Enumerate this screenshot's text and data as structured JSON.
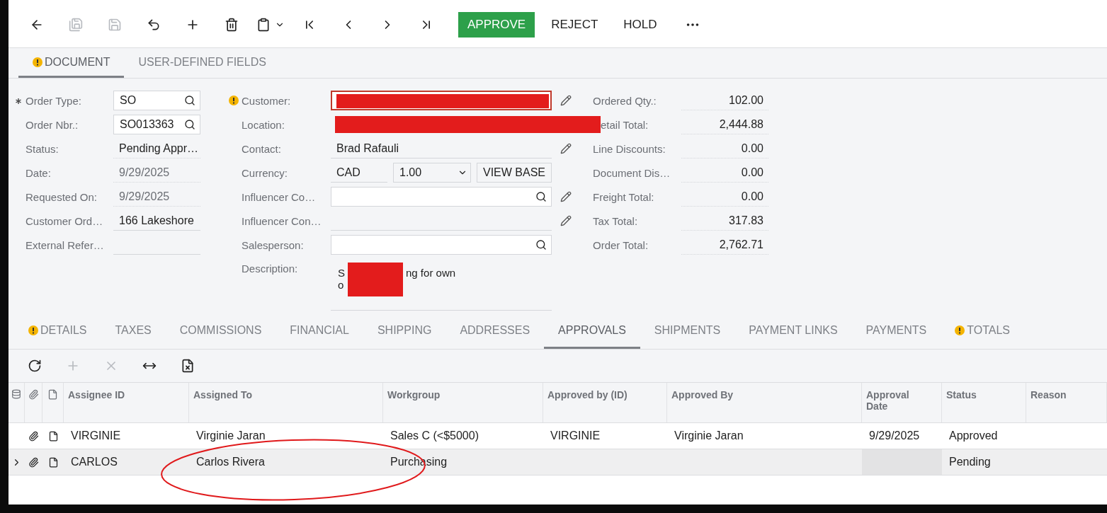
{
  "toolbar": {
    "icons": [
      {
        "disabled": false
      },
      {
        "disabled": true
      },
      {
        "disabled": true
      },
      {
        "disabled": false
      },
      {
        "disabled": false
      },
      {
        "disabled": false
      },
      {
        "disabled": false
      },
      {
        "disabled": false
      },
      {
        "disabled": false
      },
      {
        "disabled": false
      },
      {
        "disabled": false
      }
    ],
    "buttons": [
      {
        "label": "APPROVE",
        "primary": true
      },
      {
        "label": "REJECT",
        "primary": false
      },
      {
        "label": "HOLD",
        "primary": false
      }
    ]
  },
  "tabs": [
    {
      "label": "DOCUMENT",
      "selected": true,
      "warning": true
    },
    {
      "label": "USER-DEFINED FIELDS",
      "selected": false,
      "warning": false
    }
  ],
  "form": {
    "column_1": [
      {
        "kind": "lookup",
        "label": "Order Type:",
        "required": true,
        "value": "SO"
      },
      {
        "kind": "lookup",
        "label": "Order Nbr.:",
        "required": false,
        "value": "SO013363"
      },
      {
        "kind": "display",
        "label": "Status:",
        "value": "Pending Appr…",
        "disabled": false
      },
      {
        "kind": "display",
        "label": "Date:",
        "value": "9/29/2025",
        "disabled": true
      },
      {
        "kind": "display",
        "label": "Requested On:",
        "value": "9/29/2025",
        "disabled": true
      },
      {
        "kind": "text",
        "label": "Customer Ord…",
        "value": "166 Lakeshore"
      },
      {
        "kind": "text",
        "label": "External Refer…"
      }
    ],
    "column_2": [
      {
        "kind": "redacted",
        "label": "Customer:",
        "warning": true,
        "error": true,
        "edit": true
      },
      {
        "kind": "redacted-wide",
        "label": "Location:",
        "warning": false,
        "error": false,
        "edit": false
      },
      {
        "kind": "text",
        "label": "Contact:",
        "value": "Brad Rafauli",
        "edit": true
      },
      {
        "kind": "currency",
        "label": "Currency:",
        "value": "CAD",
        "rate": "1.00",
        "button": "VIEW BASE",
        "edit": false
      },
      {
        "kind": "lookup",
        "label": "Influencer Co…",
        "edit": true
      },
      {
        "kind": "text",
        "label": "Influencer Con…",
        "edit": true
      },
      {
        "kind": "lookup",
        "label": "Salesperson:",
        "edit": false
      },
      {
        "kind": "textarea",
        "label": "Description:",
        "fragments": [
          "S",
          "ng for own",
          "o"
        ],
        "redacted": true,
        "edit": false
      }
    ],
    "column_3": [
      {
        "label": "Ordered Qty.:",
        "value": "102.00",
        "clipped": false
      },
      {
        "label": "etail Total:",
        "value": "2,444.88",
        "clipped": true
      },
      {
        "label": "Line Discounts:",
        "value": "0.00",
        "clipped": false
      },
      {
        "label": "Document Dis…",
        "value": "0.00",
        "clipped": false
      },
      {
        "label": "Freight Total:",
        "value": "0.00",
        "clipped": false
      },
      {
        "label": "Tax Total:",
        "value": "317.83",
        "clipped": false
      },
      {
        "label": "Order Total:",
        "value": "2,762.71",
        "clipped": false
      }
    ]
  },
  "detail_tabs": [
    {
      "label": "DETAILS",
      "selected": false,
      "warning": true
    },
    {
      "label": "TAXES",
      "selected": false,
      "warning": false
    },
    {
      "label": "COMMISSIONS",
      "selected": false,
      "warning": false
    },
    {
      "label": "FINANCIAL",
      "selected": false,
      "warning": false
    },
    {
      "label": "SHIPPING",
      "selected": false,
      "warning": false
    },
    {
      "label": "ADDRESSES",
      "selected": false,
      "warning": false
    },
    {
      "label": "APPROVALS",
      "selected": true,
      "warning": false
    },
    {
      "label": "SHIPMENTS",
      "selected": false,
      "warning": false
    },
    {
      "label": "PAYMENT LINKS",
      "selected": false,
      "warning": false
    },
    {
      "label": "PAYMENTS",
      "selected": false,
      "warning": false
    },
    {
      "label": "TOTALS",
      "selected": false,
      "warning": true
    }
  ],
  "grid_toolbar": [
    {
      "disabled": false
    },
    {
      "disabled": true
    },
    {
      "disabled": true
    },
    {
      "disabled": false
    },
    {
      "disabled": false
    }
  ],
  "table": {
    "columns": [
      "Assignee ID",
      "Assigned To",
      "Workgroup",
      "Approved by (ID)",
      "Approved By",
      "Approval Date",
      "Status",
      "Reason"
    ],
    "rows": [
      {
        "selected": false,
        "cells": [
          "VIRGINIE",
          "Virginie Jaran",
          "Sales C (<$5000)",
          "VIRGINIE",
          "Virginie Jaran",
          "9/29/2025",
          "Approved",
          ""
        ]
      },
      {
        "selected": true,
        "cells": [
          "CARLOS",
          "Carlos Rivera",
          "Purchasing",
          "",
          "",
          "",
          "Pending",
          ""
        ]
      }
    ]
  },
  "annotations": [
    {
      "kind": "ellipse"
    }
  ]
}
